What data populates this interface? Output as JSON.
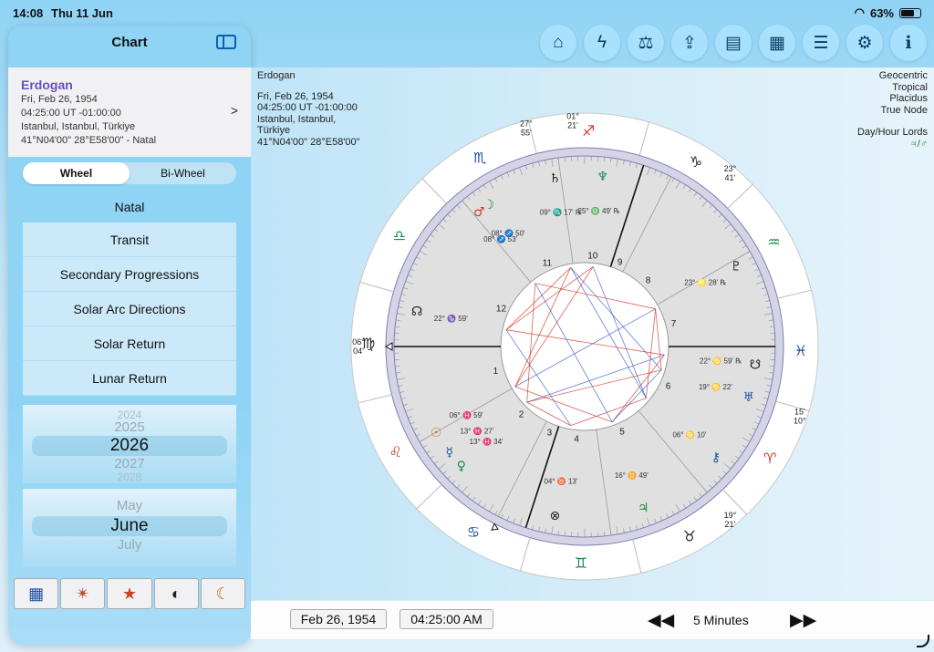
{
  "status": {
    "time": "14:08",
    "date": "Thu 11 Jun",
    "battery": "63%"
  },
  "sidebar": {
    "title": "Chart",
    "card": {
      "name": "Erdogan",
      "date": "Fri, Feb 26, 1954",
      "time": "04:25:00 UT -01:00:00",
      "place": "Istanbul, Istanbul, Türkiye",
      "coords": "41°N04'00\" 28°E58'00\" - Natal",
      "chevron": ">"
    },
    "segments": [
      "Wheel",
      "Bi-Wheel"
    ],
    "natal_label": "Natal",
    "chart_types": [
      "Transit",
      "Secondary Progressions",
      "Solar Arc Directions",
      "Solar Return",
      "Lunar Return"
    ],
    "year_picker": {
      "prev2": "2024",
      "prev": "2025",
      "selected": "2026",
      "next": "2027",
      "next2": "2028"
    },
    "month_picker": {
      "prev": "May",
      "selected": "June",
      "next": "July"
    },
    "bottom_tabs": [
      {
        "icon": "grid-icon",
        "glyph": "▦"
      },
      {
        "icon": "aspect-star-icon",
        "glyph": "✴"
      },
      {
        "icon": "stars-icon",
        "glyph": "★"
      },
      {
        "icon": "eclipse-icon",
        "glyph": "◐"
      },
      {
        "icon": "moon-icon",
        "glyph": "☾"
      }
    ]
  },
  "toolbar": [
    {
      "icon": "home-icon",
      "glyph": "⌂"
    },
    {
      "icon": "lightning-icon",
      "glyph": "ϟ"
    },
    {
      "icon": "scales-icon",
      "glyph": "⚖"
    },
    {
      "icon": "share-icon",
      "glyph": "⇪"
    },
    {
      "icon": "document-icon",
      "glyph": "▤"
    },
    {
      "icon": "calculator-icon",
      "glyph": "▦"
    },
    {
      "icon": "list-icon",
      "glyph": "☰"
    },
    {
      "icon": "settings-icon",
      "glyph": "⚙"
    },
    {
      "icon": "info-icon",
      "glyph": "i"
    }
  ],
  "chart_info": {
    "name": "Erdogan",
    "date": "Fri, Feb 26, 1954",
    "time": "04:25:00 UT -01:00:00",
    "place1": "Istanbul, Istanbul,",
    "place2": "Türkiye",
    "coords": "41°N04'00\" 28°E58'00\""
  },
  "chart_options": {
    "geo": "Geocentric",
    "zodiac": "Tropical",
    "houses": "Placidus",
    "node": "True Node",
    "lords_label": "Day/Hour Lords",
    "lords_value": "♃/♂"
  },
  "wheel": {
    "sign_glyphs": [
      "♒",
      "♑",
      "♐",
      "♏",
      "♎",
      "♍",
      "♌",
      "♋",
      "♊",
      "♉",
      "♈",
      "♓"
    ],
    "house_numbers": [
      "1",
      "2",
      "3",
      "4",
      "5",
      "6",
      "7",
      "8",
      "9",
      "10",
      "11",
      "12"
    ],
    "cusp_labels": [
      {
        "deg": "06°",
        "min": "04'"
      },
      {
        "deg": "01°",
        "min": "21'"
      },
      {
        "deg": "27°",
        "min": "55'"
      },
      {
        "deg": "23°",
        "min": "41'"
      },
      {
        "deg": "19°",
        "min": "21'"
      },
      {
        "deg": "15'",
        "min": "10°"
      }
    ],
    "planets": [
      {
        "glyph": "♄",
        "text": "09° ♏ 17' ℞"
      },
      {
        "glyph": "♆",
        "text": "25° ♎ 49' ℞"
      },
      {
        "glyph": "♂",
        "text": "08° ♐ 53'"
      },
      {
        "glyph": "☽",
        "text": "08° ♐ 50'"
      },
      {
        "glyph": "☊",
        "text": "22° ♑ 59'"
      },
      {
        "glyph": "♇",
        "text": "23° ♌ 28' ℞"
      },
      {
        "glyph": "☋",
        "text": "22° ♋ 59' ℞"
      },
      {
        "glyph": "♅",
        "text": "19° ♋ 22'"
      },
      {
        "glyph": "⚷",
        "text": "06° ♋ 10'"
      },
      {
        "glyph": "♃",
        "text": "16° ♊ 49'"
      },
      {
        "glyph": "⊗",
        "text": "04° ♉ 13'"
      },
      {
        "glyph": "☉",
        "text": "06° ♓ 59'"
      },
      {
        "glyph": "☿",
        "text": "13° ♓ 27'"
      },
      {
        "glyph": "♀",
        "text": "13° ♓ 34'"
      }
    ]
  },
  "bottom": {
    "date": "Feb 26, 1954",
    "time": "04:25:00 AM",
    "rewind": "◀◀",
    "step": "5 Minutes",
    "forward": "▶▶"
  }
}
